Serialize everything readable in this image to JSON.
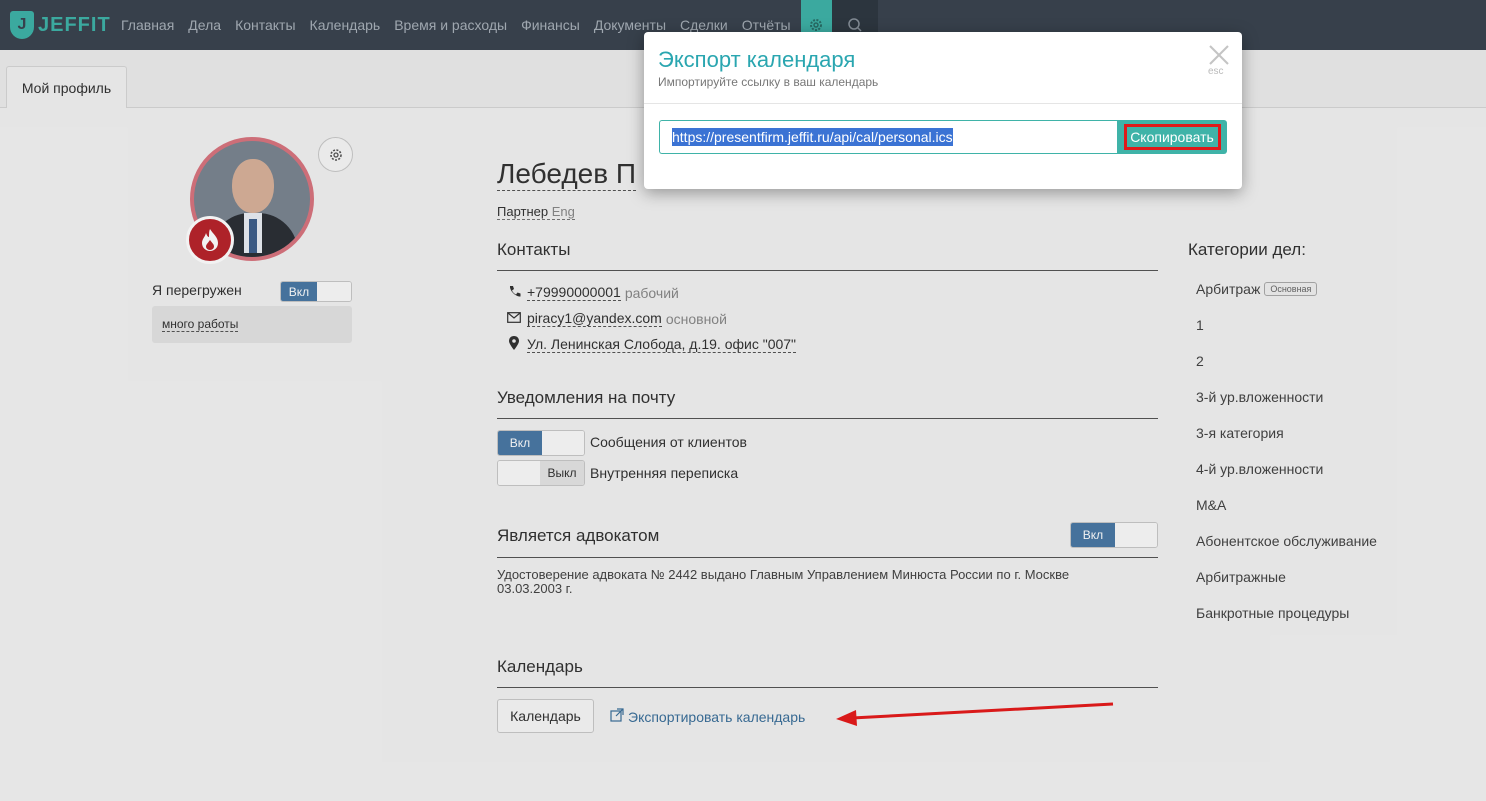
{
  "nav": {
    "logo_text": "JEFFIT",
    "items": [
      "Главная",
      "Дела",
      "Контакты",
      "Календарь",
      "Время и расходы",
      "Финансы",
      "Документы",
      "Сделки",
      "Отчёты"
    ]
  },
  "tabs": [
    "Мой профиль"
  ],
  "profile": {
    "overload_label": "Я перегружен",
    "overload_toggle": "Вкл",
    "overload_note": "много работы",
    "name": "Лебедев П",
    "role": "Партнер",
    "role_lang": "Eng"
  },
  "contacts": {
    "title": "Контакты",
    "phone": "+79990000001",
    "phone_type": "рабочий",
    "email": "piracy1@yandex.com",
    "email_type": "основной",
    "address": "Ул. Ленинская Слобода, д.19. офис \"007\""
  },
  "notifications": {
    "title": "Уведомления на почту",
    "items": [
      {
        "toggle": "Вкл",
        "label": "Сообщения от клиентов"
      },
      {
        "toggle": "Выкл",
        "label": "Внутренняя переписка"
      }
    ]
  },
  "lawyer": {
    "title": "Является адвокатом",
    "toggle": "Вкл",
    "text": "Удостоверение адвоката № 2442 выдано Главным Управлением Минюста России по г. Москве 03.03.2003 г."
  },
  "calendar": {
    "title": "Календарь",
    "button": "Календарь",
    "export_link": "Экспортировать календарь"
  },
  "categories": {
    "title": "Категории дел:",
    "items": [
      "Арбитраж",
      "1",
      "2",
      "3-й ур.вложенности",
      "3-я категория",
      "4-й ур.вложенности",
      "M&A",
      "Абонентское обслуживание",
      "Арбитражные",
      "Банкротные процедуры"
    ],
    "first_badge": "Основная"
  },
  "modal": {
    "title": "Экспорт календаря",
    "subtitle": "Импортируйте ссылку в ваш календарь",
    "esc": "esc",
    "url": "https://presentfirm.jeffit.ru/api/cal/personal.ics",
    "copy_button": "Скопировать"
  },
  "colors": {
    "nav_bg": "#3a4450",
    "accent": "#3fb3a8",
    "toggle_on": "#4a79a5",
    "highlight_red": "#e01a1a"
  }
}
